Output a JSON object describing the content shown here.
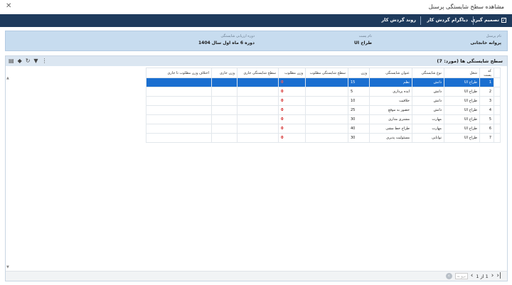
{
  "window": {
    "title": "مشاهده سطح شایستگی پرسنل",
    "close_glyph": "✕"
  },
  "toolbar": {
    "decision_label": "تصمیم گیری",
    "diagram_label": "دیاگرام گردش کار",
    "workflow_label": "روند گردش کار"
  },
  "info": {
    "personnel_label": "نام پرسنل",
    "personnel_value": "پروانه خانجانی",
    "position_label": "نام پست",
    "position_value": "طراح UI",
    "period_label": "دوره ارزیابی شایستگی",
    "period_value": "دوره 6 ماه اول سال 1404"
  },
  "panel": {
    "title": "سطح شایستگی ها (مورد: 7)"
  },
  "grid": {
    "headers": [
      "",
      "کد پست",
      "شغل",
      "نوع شایستگی",
      "عنوان شایستگی",
      "وزن",
      "سطح شایستگی مطلوب",
      "وزن مطلوب",
      "سطح شایستگی جاری",
      "وزن جاری",
      "اختلاف وزن مطلوب تا جاری"
    ],
    "rows": [
      {
        "idx": "1",
        "job": "طراح UI",
        "type": "دانش",
        "title": "نظم",
        "weight": "15",
        "target_level": "",
        "target_weight": "0"
      },
      {
        "idx": "2",
        "job": "طراح UI",
        "type": "دانش",
        "title": "ایده پردازی",
        "weight": "5",
        "target_level": "",
        "target_weight": "0"
      },
      {
        "idx": "3",
        "job": "طراح UI",
        "type": "دانش",
        "title": "خلاقیت",
        "weight": "10",
        "target_level": "",
        "target_weight": "0"
      },
      {
        "idx": "4",
        "job": "طراح UI",
        "type": "دانش",
        "title": "حضور به موقع",
        "weight": "25",
        "target_level": "",
        "target_weight": "0"
      },
      {
        "idx": "5",
        "job": "طراح UI",
        "type": "مهارت",
        "title": "مشتری مداری",
        "weight": "30",
        "target_level": "",
        "target_weight": "0"
      },
      {
        "idx": "6",
        "job": "طراح UI",
        "type": "مهارت",
        "title": "طراح خط مشی",
        "weight": "40",
        "target_level": "",
        "target_weight": "0"
      },
      {
        "idx": "7",
        "job": "طراح UI",
        "type": "توانایی",
        "title": "مسئولیت پذیری",
        "weight": "30",
        "target_level": "",
        "target_weight": "0"
      }
    ]
  },
  "pager": {
    "page_info": "1 از 1",
    "goto_placeholder": "برو به"
  },
  "colors": {
    "toolbar_bg": "#1e3a5c",
    "selected_row": "#1a6fd0",
    "alert_red": "#d01a1a"
  }
}
